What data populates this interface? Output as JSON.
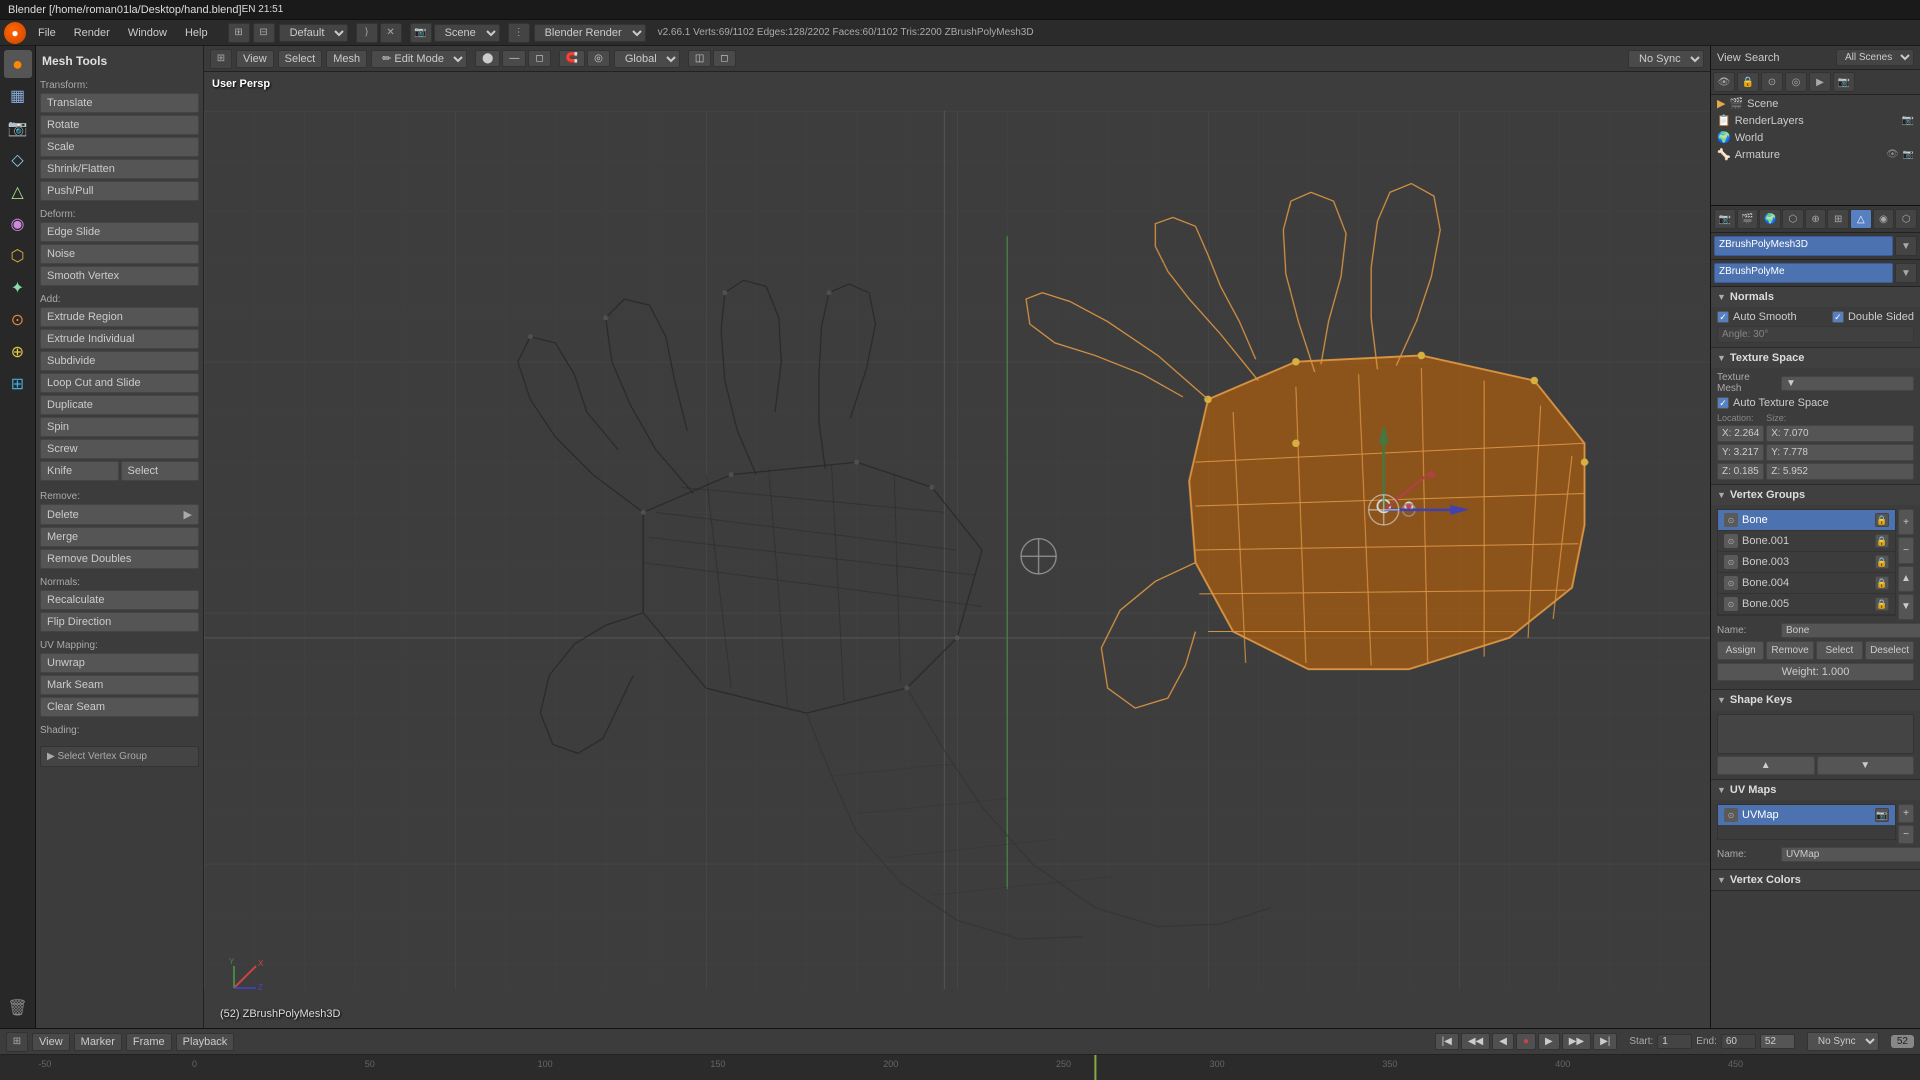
{
  "titlebar": {
    "title": "Blender  [/home/roman01la/Desktop/hand.blend]",
    "right": "EN  21:51"
  },
  "blender_header": {
    "logo": "●",
    "menus": [
      "File",
      "Render",
      "Window",
      "Help"
    ],
    "layout_select": "Default",
    "scene_select": "Scene",
    "engine_select": "Blender Render",
    "version_info": "v2.66.1  Verts:69/1102  Edges:128/2202  Faces:60/1102  Tris:2200  ZBrushPolyMesh3D"
  },
  "mesh_tools": {
    "title": "Mesh Tools",
    "transform": {
      "label": "Transform:",
      "buttons": [
        "Translate",
        "Rotate",
        "Scale",
        "Shrink/Flatten",
        "Push/Pull"
      ]
    },
    "deform": {
      "label": "Deform:",
      "buttons": [
        "Edge Slide",
        "Noise",
        "Smooth Vertex"
      ]
    },
    "add": {
      "label": "Add:",
      "buttons": [
        "Extrude Region",
        "Extrude Individual",
        "Subdivide",
        "Loop Cut and Slide",
        "Duplicate",
        "Spin",
        "Screw"
      ]
    },
    "knife_select": {
      "knife": "Knife",
      "select": "Select"
    },
    "remove": {
      "label": "Remove:",
      "delete": "Delete",
      "merge": "Merge",
      "remove_doubles": "Remove Doubles"
    },
    "normals": {
      "label": "Normals:",
      "recalculate": "Recalculate",
      "flip_direction": "Flip Direction"
    },
    "uv_mapping": {
      "label": "UV Mapping:",
      "unwrap": "Unwrap",
      "mark_seam": "Mark Seam",
      "clear_seam": "Clear Seam"
    },
    "shading": {
      "label": "Shading:"
    },
    "select_vertex_group": "Select Vertex Group"
  },
  "viewport": {
    "label": "User Persp",
    "mode_label": "(52) ZBrushPolyMesh3D",
    "bottom_toolbar": {
      "icon_btn": "⊞",
      "view": "View",
      "select": "Select",
      "mesh": "Mesh",
      "mode": "Edit Mode",
      "global": "Global",
      "sync": "No Sync"
    }
  },
  "outline": {
    "header_labels": [
      "View",
      "Search",
      "All Scenes"
    ],
    "scene_select": "All Scenes",
    "items": [
      {
        "name": "Scene",
        "icon": "🎬",
        "indent": 0
      },
      {
        "name": "RenderLayers",
        "icon": "📷",
        "indent": 1
      },
      {
        "name": "World",
        "icon": "🌍",
        "indent": 1
      },
      {
        "name": "Armature",
        "icon": "🦴",
        "indent": 1
      }
    ]
  },
  "properties": {
    "active_object": "ZBrushPolyMesh3D",
    "active_subobj": "ZBrushPolyMe",
    "normals_section": {
      "label": "Normals",
      "auto_smooth": "Auto Smooth",
      "double_sided": "Double Sided",
      "angle": "Angle: 30°"
    },
    "texture_space": {
      "label": "Texture Space",
      "texture_mesh": "Texture Mesh",
      "auto_texture_space": "Auto Texture Space",
      "location": {
        "x": "X: 2.264",
        "y": "Y: 3.217",
        "z": "Z: 0.185"
      },
      "size": {
        "x": "X: 7.070",
        "y": "Y: 7.778",
        "z": "Z: 5.952"
      }
    },
    "vertex_groups": {
      "label": "Vertex Groups",
      "items": [
        {
          "name": "Bone",
          "active": true
        },
        {
          "name": "Bone.001",
          "active": false
        },
        {
          "name": "Bone.003",
          "active": false
        },
        {
          "name": "Bone.004",
          "active": false
        },
        {
          "name": "Bone.005",
          "active": false
        }
      ],
      "name_field": "Bone",
      "assign": "Assign",
      "remove": "Remove",
      "select": "Select",
      "deselect": "Deselect",
      "weight_label": "Weight: 1.000"
    },
    "shape_keys": {
      "label": "Shape Keys"
    },
    "uv_maps": {
      "label": "UV Maps",
      "items": [
        {
          "name": "UVMap",
          "active": true
        }
      ],
      "name_field": "UVMap"
    },
    "vertex_colors": {
      "label": "Vertex Colors"
    }
  },
  "timeline": {
    "start": "Start: 1",
    "end": "End: 60",
    "current_frame": "52",
    "playback_label": "No Sync",
    "ruler_marks": [
      "-50",
      "0",
      "50",
      "100",
      "150",
      "200",
      "250",
      "300"
    ],
    "buttons": {
      "view": "View",
      "marker": "Marker",
      "frame": "Frame",
      "playback": "Playback"
    }
  }
}
